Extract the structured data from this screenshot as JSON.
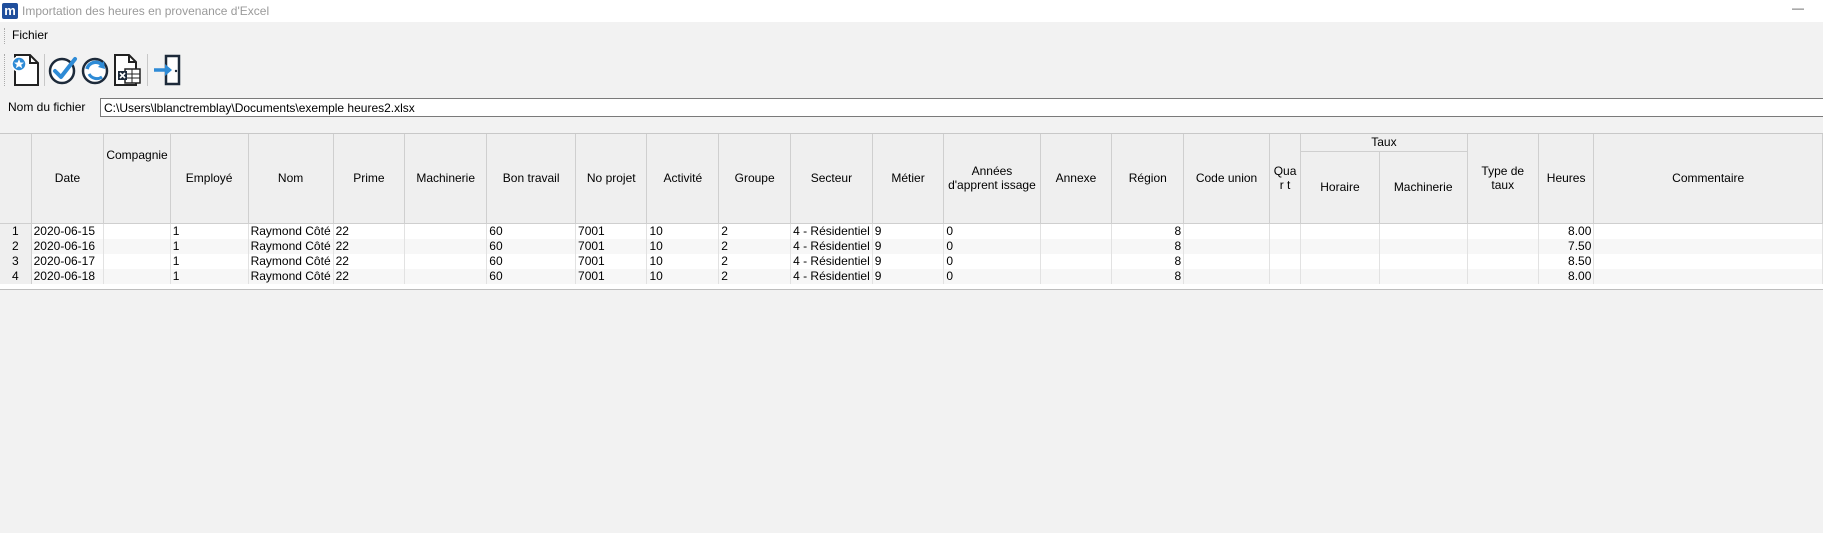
{
  "window": {
    "title": "Importation des heures en provenance d'Excel",
    "app_icon_letter": "m",
    "minimize_glyph": "—"
  },
  "menu": {
    "items": [
      "Fichier"
    ]
  },
  "toolbar": {
    "buttons": [
      "new-document-icon",
      "validate-check-icon",
      "refresh-icon",
      "excel-file-icon",
      "exit-door-icon"
    ]
  },
  "file": {
    "label": "Nom du fichier",
    "value": "C:\\Users\\lblanctremblay\\Documents\\exemple heures2.xlsx"
  },
  "grid": {
    "columns": {
      "date": "Date",
      "compagnie": "Compagnie",
      "employe": "Employé",
      "nom": "Nom",
      "prime": "Prime",
      "machinerie": "Machinerie",
      "bon_travail": "Bon travail",
      "no_projet": "No projet",
      "activite": "Activité",
      "groupe": "Groupe",
      "secteur": "Secteur",
      "metier": "Métier",
      "annees": "Années d'apprent issage",
      "annexe": "Annexe",
      "region": "Région",
      "code_union": "Code union",
      "quart": "Quar t",
      "taux": "Taux",
      "taux_horaire": "Horaire",
      "taux_machinerie": "Machinerie",
      "type_taux": "Type de taux",
      "heures": "Heures",
      "commentaire": "Commentaire"
    },
    "rows": [
      {
        "n": "1",
        "date": "2020-06-15",
        "compagnie": "",
        "employe": "1",
        "nom": "Raymond Côté",
        "prime": "22",
        "machinerie": "",
        "bon_travail": "60",
        "no_projet": "7001",
        "activite": "10",
        "groupe": "2",
        "secteur": "4 - Résidentiel",
        "metier": "9",
        "annees": "0",
        "annexe": "",
        "region": "8",
        "code_union": "",
        "quart": "",
        "taux_horaire": "",
        "taux_machinerie": "",
        "type_taux": "",
        "heures": "8.00",
        "commentaire": ""
      },
      {
        "n": "2",
        "date": "2020-06-16",
        "compagnie": "",
        "employe": "1",
        "nom": "Raymond Côté",
        "prime": "22",
        "machinerie": "",
        "bon_travail": "60",
        "no_projet": "7001",
        "activite": "10",
        "groupe": "2",
        "secteur": "4 - Résidentiel",
        "metier": "9",
        "annees": "0",
        "annexe": "",
        "region": "8",
        "code_union": "",
        "quart": "",
        "taux_horaire": "",
        "taux_machinerie": "",
        "type_taux": "",
        "heures": "7.50",
        "commentaire": ""
      },
      {
        "n": "3",
        "date": "2020-06-17",
        "compagnie": "",
        "employe": "1",
        "nom": "Raymond Côté",
        "prime": "22",
        "machinerie": "",
        "bon_travail": "60",
        "no_projet": "7001",
        "activite": "10",
        "groupe": "2",
        "secteur": "4 - Résidentiel",
        "metier": "9",
        "annees": "0",
        "annexe": "",
        "region": "8",
        "code_union": "",
        "quart": "",
        "taux_horaire": "",
        "taux_machinerie": "",
        "type_taux": "",
        "heures": "8.50",
        "commentaire": ""
      },
      {
        "n": "4",
        "date": "2020-06-18",
        "compagnie": "",
        "employe": "1",
        "nom": "Raymond Côté",
        "prime": "22",
        "machinerie": "",
        "bon_travail": "60",
        "no_projet": "7001",
        "activite": "10",
        "groupe": "2",
        "secteur": "4 - Résidentiel",
        "metier": "9",
        "annees": "0",
        "annexe": "",
        "region": "8",
        "code_union": "",
        "quart": "",
        "taux_horaire": "",
        "taux_machinerie": "",
        "type_taux": "",
        "heures": "8.00",
        "commentaire": ""
      }
    ]
  }
}
